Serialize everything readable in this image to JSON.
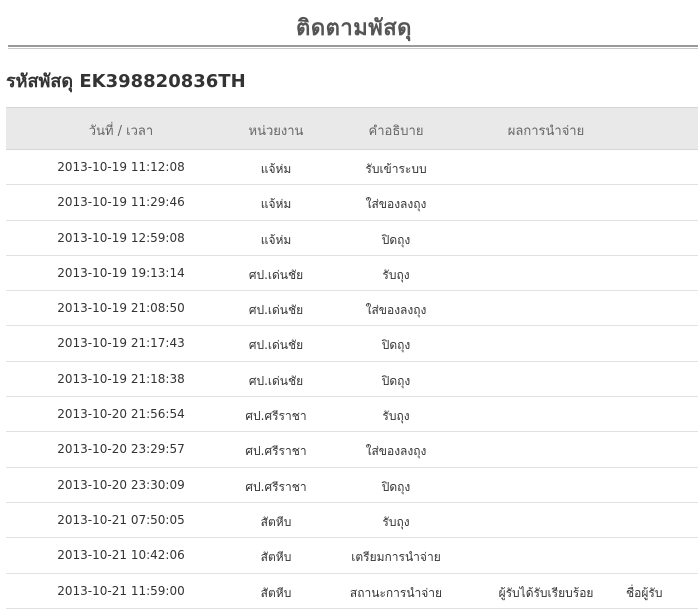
{
  "page": {
    "title": "ติดตามพัสดุ"
  },
  "tracking": {
    "heading": "รหัสพัสดุ EK398820836TH"
  },
  "table": {
    "headers": {
      "datetime": "วันที่ / เวลา",
      "office": "หน่วยงาน",
      "description": "คำอธิบาย",
      "result": "ผลการนำจ่าย"
    },
    "rows": [
      {
        "datetime": "2013-10-19 11:12:08",
        "office": "แจ้ห่ม",
        "description": "รับเข้าระบบ",
        "result": "",
        "receiver": ""
      },
      {
        "datetime": "2013-10-19 11:29:46",
        "office": "แจ้ห่ม",
        "description": "ใส่ของลงถุง",
        "result": "",
        "receiver": ""
      },
      {
        "datetime": "2013-10-19 12:59:08",
        "office": "แจ้ห่ม",
        "description": "ปิดถุง",
        "result": "",
        "receiver": ""
      },
      {
        "datetime": "2013-10-19 19:13:14",
        "office": "ศป.เด่นชัย",
        "description": "รับถุง",
        "result": "",
        "receiver": ""
      },
      {
        "datetime": "2013-10-19 21:08:50",
        "office": "ศป.เด่นชัย",
        "description": "ใส่ของลงถุง",
        "result": "",
        "receiver": ""
      },
      {
        "datetime": "2013-10-19 21:17:43",
        "office": "ศป.เด่นชัย",
        "description": "ปิดถุง",
        "result": "",
        "receiver": ""
      },
      {
        "datetime": "2013-10-19 21:18:38",
        "office": "ศป.เด่นชัย",
        "description": "ปิดถุง",
        "result": "",
        "receiver": ""
      },
      {
        "datetime": "2013-10-20 21:56:54",
        "office": "ศป.ศรีราชา",
        "description": "รับถุง",
        "result": "",
        "receiver": ""
      },
      {
        "datetime": "2013-10-20 23:29:57",
        "office": "ศป.ศรีราชา",
        "description": "ใส่ของลงถุง",
        "result": "",
        "receiver": ""
      },
      {
        "datetime": "2013-10-20 23:30:09",
        "office": "ศป.ศรีราชา",
        "description": "ปิดถุง",
        "result": "",
        "receiver": ""
      },
      {
        "datetime": "2013-10-21 07:50:05",
        "office": "สัตหีบ",
        "description": "รับถุง",
        "result": "",
        "receiver": ""
      },
      {
        "datetime": "2013-10-21 10:42:06",
        "office": "สัตหีบ",
        "description": "เตรียมการนำจ่าย",
        "result": "",
        "receiver": ""
      },
      {
        "datetime": "2013-10-21 11:59:00",
        "office": "สัตหีบ",
        "description": "สถานะการนำจ่าย",
        "result": "ผู้รับได้รับเรียบร้อย",
        "receiver": "ชื่อผู้รับ"
      }
    ]
  }
}
